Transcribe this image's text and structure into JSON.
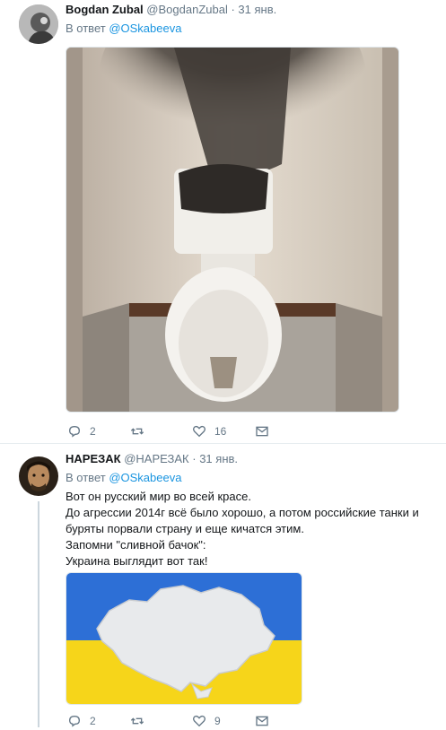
{
  "tweets": [
    {
      "name": "Bogdan Zubal",
      "handle": "@BogdanZubal",
      "date": "· 31 янв.",
      "reply_prefix": "В ответ",
      "reply_mention": "@OSkabeeva",
      "image_desc": "toilet-photo",
      "actions": {
        "reply": "2",
        "retweet": "",
        "like": "16",
        "dm": ""
      }
    },
    {
      "name": "НАРЕЗАК",
      "handle": "@НАРЕЗАК",
      "date": "· 31 янв.",
      "reply_prefix": "В ответ",
      "reply_mention": "@OSkabeeva",
      "lines": [
        "Вот он русский мир во всей красе.",
        "До агрессии 2014г всё было хорошо, а потом российские танки и буряты порвали страну и еще кичатся этим.",
        "Запомни \"сливной бачок\":",
        "Украина выглядит вот так!"
      ],
      "image_desc": "ukraine-map",
      "actions": {
        "reply": "2",
        "retweet": "",
        "like": "9",
        "dm": ""
      }
    }
  ],
  "colors": {
    "link": "#1b95e0",
    "muted": "#657786",
    "flag_blue": "#2d6fd6",
    "flag_yellow": "#f6d51a"
  }
}
